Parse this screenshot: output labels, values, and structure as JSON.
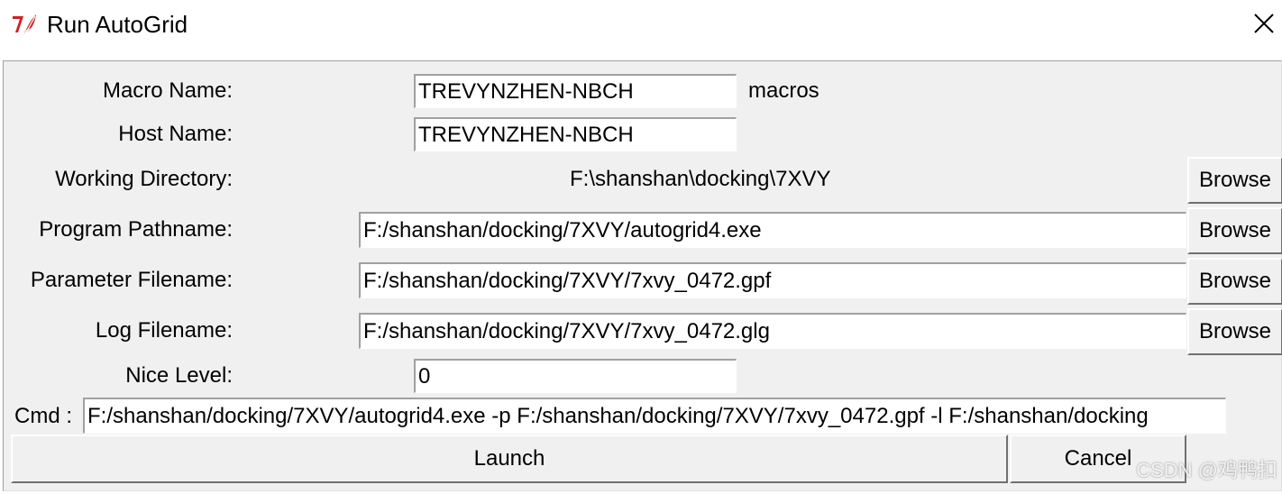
{
  "window": {
    "title": "Run AutoGrid",
    "logo_icon": "tk-feather-icon",
    "close_icon": "close-icon"
  },
  "form": {
    "macro_name": {
      "label": "Macro Name:",
      "value": "TREVYNZHEN-NBCH",
      "suffix": "macros"
    },
    "host_name": {
      "label": "Host Name:",
      "value": "TREVYNZHEN-NBCH"
    },
    "working_directory": {
      "label": "Working Directory:",
      "value": "F:\\shanshan\\docking\\7XVY",
      "browse": "Browse"
    },
    "program_pathname": {
      "label": "Program Pathname:",
      "value": "F:/shanshan/docking/7XVY/autogrid4.exe",
      "browse": "Browse"
    },
    "parameter_filename": {
      "label": "Parameter Filename:",
      "value": "F:/shanshan/docking/7XVY/7xvy_0472.gpf",
      "browse": "Browse"
    },
    "log_filename": {
      "label": "Log Filename:",
      "value": "F:/shanshan/docking/7XVY/7xvy_0472.glg",
      "browse": "Browse"
    },
    "nice_level": {
      "label": "Nice Level:",
      "value": "0"
    },
    "cmd": {
      "label": "Cmd :",
      "value": "F:/shanshan/docking/7XVY/autogrid4.exe -p F:/shanshan/docking/7XVY/7xvy_0472.gpf -l F:/shanshan/docking"
    }
  },
  "actions": {
    "launch": "Launch",
    "cancel": "Cancel"
  },
  "watermark": "CSDN @鸡鸭扣"
}
